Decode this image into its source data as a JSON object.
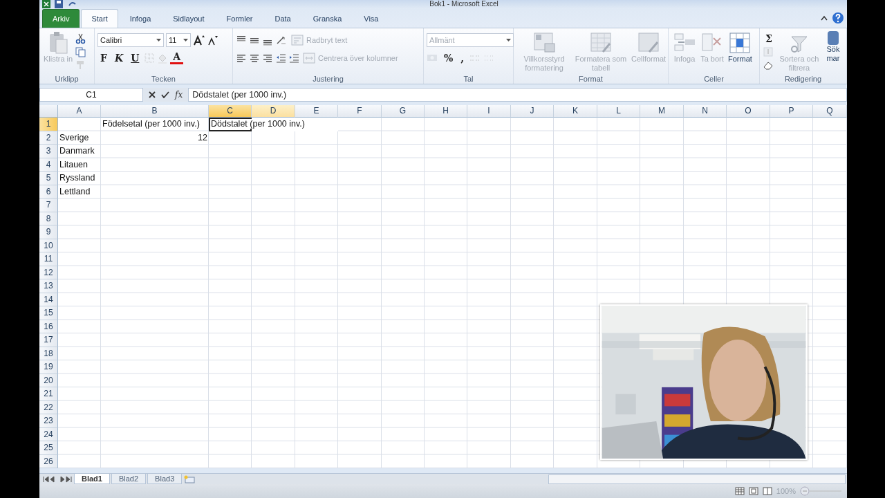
{
  "window": {
    "title": "Bok1  -  Microsoft Excel"
  },
  "ribbon_tabs": [
    {
      "label": "Arkiv",
      "kind": "file",
      "selected": false
    },
    {
      "label": "Start",
      "kind": "tab",
      "selected": true
    },
    {
      "label": "Infoga",
      "kind": "tab",
      "selected": false
    },
    {
      "label": "Sidlayout",
      "kind": "tab",
      "selected": false
    },
    {
      "label": "Formler",
      "kind": "tab",
      "selected": false
    },
    {
      "label": "Data",
      "kind": "tab",
      "selected": false
    },
    {
      "label": "Granska",
      "kind": "tab",
      "selected": false
    },
    {
      "label": "Visa",
      "kind": "tab",
      "selected": false
    }
  ],
  "ribbon_groups": [
    {
      "label": "Urklipp",
      "items": [
        {
          "kind": "large",
          "label": "Klistra in",
          "disabled": true
        },
        {
          "kind": "rows",
          "rows": [
            {
              "controls": [
                {
                  "kind": "icon",
                  "disabled": false
                }
              ]
            },
            {
              "controls": [
                {
                  "kind": "icon",
                  "disabled": false
                }
              ]
            },
            {
              "controls": [
                {
                  "kind": "icon",
                  "disabled": true
                }
              ]
            }
          ]
        }
      ]
    },
    {
      "label": "Tecken",
      "items": [
        {
          "kind": "rows",
          "rows": [
            {
              "controls": [
                {
                  "kind": "combo",
                  "value": "Calibri",
                  "disabled": false
                },
                {
                  "kind": "combo",
                  "value": "11",
                  "disabled": false
                },
                {
                  "kind": "icon",
                  "disabled": false
                },
                {
                  "kind": "icon",
                  "disabled": false
                }
              ]
            },
            {
              "controls": [
                {
                  "kind": "glyph",
                  "label": "F",
                  "disabled": false
                },
                {
                  "kind": "glyph",
                  "label": "K",
                  "disabled": false
                },
                {
                  "kind": "glyph",
                  "label": "U",
                  "disabled": false
                },
                {
                  "kind": "icon",
                  "disabled": true
                },
                {
                  "kind": "icon",
                  "disabled": true
                },
                {
                  "kind": "fontcolor",
                  "label": "A",
                  "disabled": false
                }
              ]
            }
          ]
        }
      ]
    },
    {
      "label": "Justering",
      "items": [
        {
          "kind": "rows",
          "rows": [
            {
              "controls": [
                {
                  "kind": "icon",
                  "disabled": false
                },
                {
                  "kind": "icon",
                  "disabled": false
                },
                {
                  "kind": "icon",
                  "disabled": false
                },
                {
                  "kind": "icon",
                  "disabled": false
                },
                {
                  "kind": "button",
                  "label": "Radbryt text",
                  "disabled": true
                }
              ]
            },
            {
              "controls": [
                {
                  "kind": "icon",
                  "disabled": false
                },
                {
                  "kind": "icon",
                  "disabled": false
                },
                {
                  "kind": "icon",
                  "disabled": false
                },
                {
                  "kind": "icon",
                  "disabled": false
                },
                {
                  "kind": "icon",
                  "disabled": false
                },
                {
                  "kind": "button",
                  "label": "Centrera över kolumner",
                  "disabled": true
                }
              ]
            }
          ]
        }
      ]
    },
    {
      "label": "Tal",
      "items": [
        {
          "kind": "rows",
          "rows": [
            {
              "controls": [
                {
                  "kind": "combo",
                  "value": "Allmänt",
                  "disabled": true
                }
              ]
            },
            {
              "controls": [
                {
                  "kind": "icon",
                  "disabled": true
                },
                {
                  "kind": "glyph",
                  "label": "%",
                  "disabled": false
                },
                {
                  "kind": "glyph",
                  "label": ",",
                  "disabled": false
                },
                {
                  "kind": "icon",
                  "disabled": true
                },
                {
                  "kind": "icon",
                  "disabled": true
                }
              ]
            }
          ]
        }
      ]
    },
    {
      "label": "Format",
      "items": [
        {
          "kind": "large",
          "label": "Villkorsstyrd formatering",
          "disabled": true
        },
        {
          "kind": "large",
          "label": "Formatera som tabell",
          "disabled": true
        },
        {
          "kind": "large",
          "label": "Cellformat",
          "disabled": true
        }
      ]
    },
    {
      "label": "Celler",
      "items": [
        {
          "kind": "large",
          "label": "Infoga",
          "disabled": true
        },
        {
          "kind": "large",
          "label": "Ta bort",
          "disabled": true
        },
        {
          "kind": "large",
          "label": "Format",
          "disabled": false
        }
      ]
    },
    {
      "label": "Redigering",
      "items": [
        {
          "kind": "rows",
          "rows": [
            {
              "controls": [
                {
                  "kind": "glyph",
                  "label": "Σ",
                  "disabled": false
                }
              ]
            },
            {
              "controls": [
                {
                  "kind": "icon",
                  "disabled": true
                }
              ]
            },
            {
              "controls": [
                {
                  "kind": "icon",
                  "disabled": false
                }
              ]
            }
          ]
        },
        {
          "kind": "large",
          "label": "Sortera och filtrera",
          "disabled": true
        },
        {
          "kind": "large",
          "label": "Sök mar",
          "disabled": false
        }
      ]
    }
  ],
  "formula_bar": {
    "name_box": "C1",
    "function_label": "fx",
    "content": "Dödstalet (per 1000 inv.)"
  },
  "columns": [
    {
      "label": "A",
      "selected": false,
      "hovered": false
    },
    {
      "label": "B",
      "selected": false,
      "hovered": false
    },
    {
      "label": "C",
      "selected": true,
      "hovered": false
    },
    {
      "label": "D",
      "selected": false,
      "hovered": true
    },
    {
      "label": "E",
      "selected": false,
      "hovered": false
    },
    {
      "label": "F",
      "selected": false,
      "hovered": false
    },
    {
      "label": "G",
      "selected": false,
      "hovered": false
    },
    {
      "label": "H",
      "selected": false,
      "hovered": false
    },
    {
      "label": "I",
      "selected": false,
      "hovered": false
    },
    {
      "label": "J",
      "selected": false,
      "hovered": false
    },
    {
      "label": "K",
      "selected": false,
      "hovered": false
    },
    {
      "label": "L",
      "selected": false,
      "hovered": false
    },
    {
      "label": "M",
      "selected": false,
      "hovered": false
    },
    {
      "label": "N",
      "selected": false,
      "hovered": false
    },
    {
      "label": "O",
      "selected": false,
      "hovered": false
    },
    {
      "label": "P",
      "selected": false,
      "hovered": false
    },
    {
      "label": "Q",
      "selected": false,
      "hovered": false
    }
  ],
  "rows": [
    {
      "label": "1",
      "selected": true,
      "cells": {
        "B": {
          "text": "Födelsetal (per 1000 inv.)"
        },
        "C": {
          "text": "Dödstalet (per 1000 inv.)",
          "editing": true
        }
      }
    },
    {
      "label": "2",
      "selected": false,
      "cells": {
        "A": {
          "text": "Sverige"
        },
        "B": {
          "text": "12",
          "kind": "number"
        }
      }
    },
    {
      "label": "3",
      "selected": false,
      "cells": {
        "A": {
          "text": "Danmark"
        }
      }
    },
    {
      "label": "4",
      "selected": false,
      "cells": {
        "A": {
          "text": "Litauen"
        }
      }
    },
    {
      "label": "5",
      "selected": false,
      "cells": {
        "A": {
          "text": "Ryssland"
        }
      }
    },
    {
      "label": "6",
      "selected": false,
      "cells": {
        "A": {
          "text": "Lettland"
        }
      }
    },
    {
      "label": "7",
      "selected": false
    },
    {
      "label": "8",
      "selected": false
    },
    {
      "label": "9",
      "selected": false
    },
    {
      "label": "10",
      "selected": false
    },
    {
      "label": "11",
      "selected": false
    },
    {
      "label": "12",
      "selected": false
    },
    {
      "label": "13",
      "selected": false
    },
    {
      "label": "14",
      "selected": false
    },
    {
      "label": "15",
      "selected": false
    },
    {
      "label": "16",
      "selected": false
    },
    {
      "label": "17",
      "selected": false
    },
    {
      "label": "18",
      "selected": false
    },
    {
      "label": "19",
      "selected": false
    },
    {
      "label": "20",
      "selected": false
    },
    {
      "label": "21",
      "selected": false
    },
    {
      "label": "22",
      "selected": false
    },
    {
      "label": "23",
      "selected": false
    },
    {
      "label": "24",
      "selected": false
    },
    {
      "label": "25",
      "selected": false
    },
    {
      "label": "26",
      "selected": false
    }
  ],
  "sheet_tabs": [
    {
      "label": "Blad1",
      "selected": true
    },
    {
      "label": "Blad2",
      "selected": false
    },
    {
      "label": "Blad3",
      "selected": false
    }
  ],
  "status_bar": {
    "zoom": "100%"
  }
}
